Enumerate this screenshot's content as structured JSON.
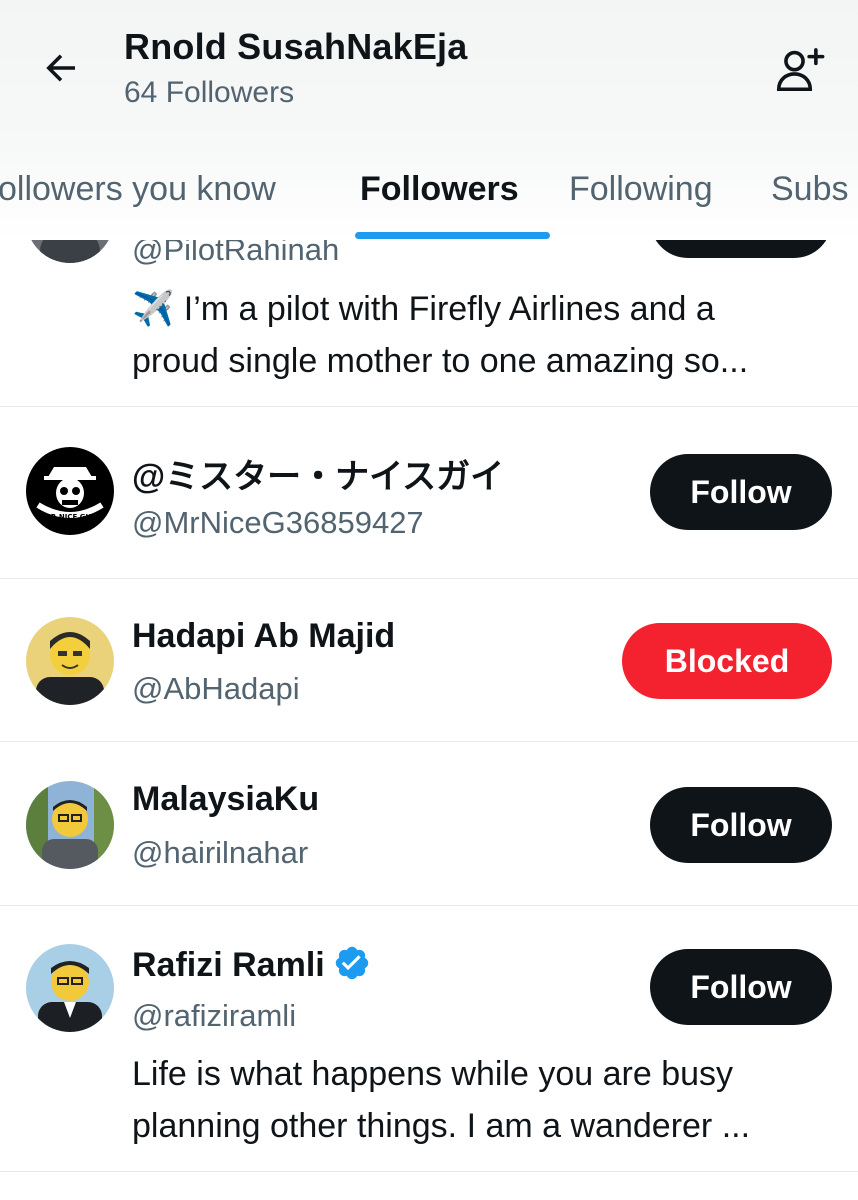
{
  "header": {
    "title": "Rnold SusahNakEja",
    "subtitle": "64 Followers",
    "back_icon": "arrow-left-icon",
    "add_user_icon": "person-add-icon"
  },
  "tabs": [
    {
      "label": "ollowers you know",
      "active": false
    },
    {
      "label": "Followers",
      "active": true
    },
    {
      "label": "Following",
      "active": false
    },
    {
      "label": "Subs",
      "active": false
    }
  ],
  "colors": {
    "accent": "#1d9bf0",
    "follow_button": "#0f1419",
    "blocked_button": "#f4212e",
    "secondary_text": "#536471",
    "divider": "#e6e9ea"
  },
  "users": [
    {
      "handle": "@PilotRahinah",
      "bio_lines": [
        "✈️ I’m a pilot with Firefly Airlines and a",
        "proud single mother to one amazing so..."
      ]
    },
    {
      "name": "@ミスター・ナイスガイ",
      "handle": "@MrNiceG36859427",
      "button": "Follow",
      "avatar_text": "MR.NICE GUY"
    },
    {
      "name": "Hadapi Ab Majid",
      "handle": "@AbHadapi",
      "button": "Blocked"
    },
    {
      "name": "MalaysiaKu",
      "handle": "@hairilnahar",
      "button": "Follow"
    },
    {
      "name": "Rafizi Ramli",
      "handle": "@rafiziramli",
      "button": "Follow",
      "verified": true,
      "bio_lines": [
        "Life is what happens while you are busy",
        "planning other things. I am a wanderer ..."
      ]
    }
  ]
}
